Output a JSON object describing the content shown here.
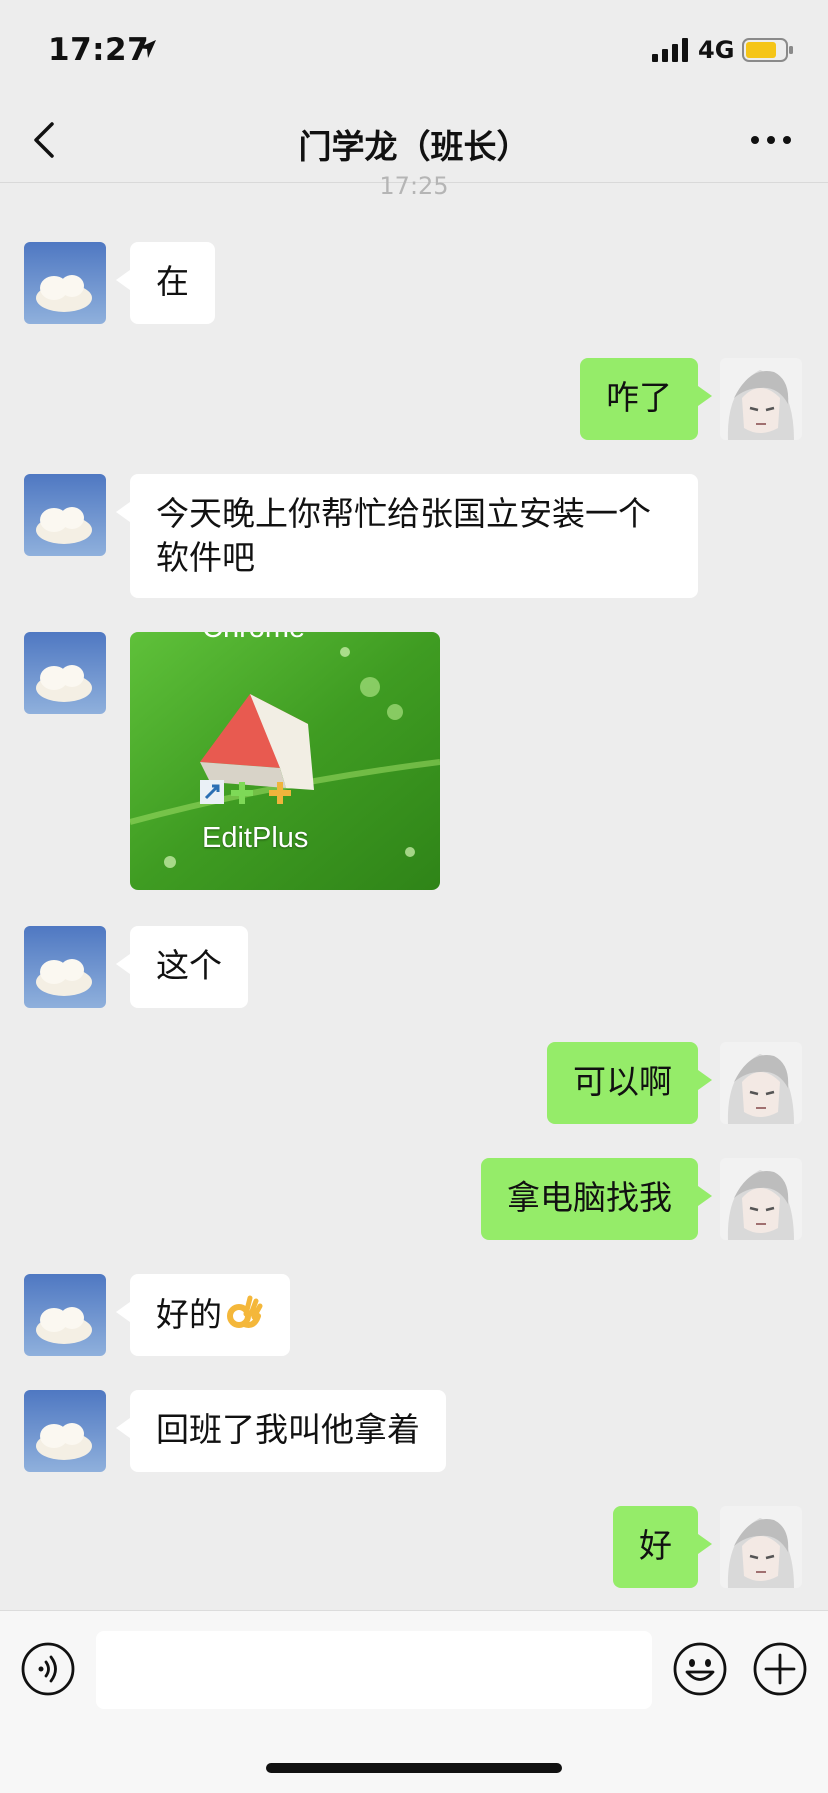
{
  "status_bar": {
    "time": "17:27",
    "network": "4G",
    "signal_icon": "signal-bars-icon",
    "battery_icon": "battery-icon"
  },
  "nav": {
    "title": "门学龙（班长）",
    "back_icon": "chevron-left-icon",
    "more_icon": "more-dots-icon"
  },
  "timestamp": "17:25",
  "messages": [
    {
      "side": "left",
      "type": "text",
      "text": "在"
    },
    {
      "side": "right",
      "type": "text",
      "text": "咋了"
    },
    {
      "side": "left",
      "type": "text",
      "text": "今天晚上你帮忙给张国立安装一个软件吧"
    },
    {
      "side": "left",
      "type": "image",
      "caption": "EditPlus",
      "caption_top_cut": "Chrome"
    },
    {
      "side": "left",
      "type": "text",
      "text": "这个"
    },
    {
      "side": "right",
      "type": "text",
      "text": "可以啊"
    },
    {
      "side": "right",
      "type": "text",
      "text": "拿电脑找我"
    },
    {
      "side": "left",
      "type": "text",
      "text": "好的",
      "emoji": "ok-hand-emoji"
    },
    {
      "side": "left",
      "type": "text",
      "text": "回班了我叫他拿着"
    },
    {
      "side": "right",
      "type": "text",
      "text": "好"
    }
  ],
  "input_bar": {
    "voice_icon": "voice-icon",
    "emoji_icon": "smiley-icon",
    "add_icon": "plus-circle-icon",
    "placeholder": ""
  },
  "colors": {
    "background": "#ededed",
    "bubble_sent": "#95ec69",
    "bubble_received": "#ffffff"
  }
}
